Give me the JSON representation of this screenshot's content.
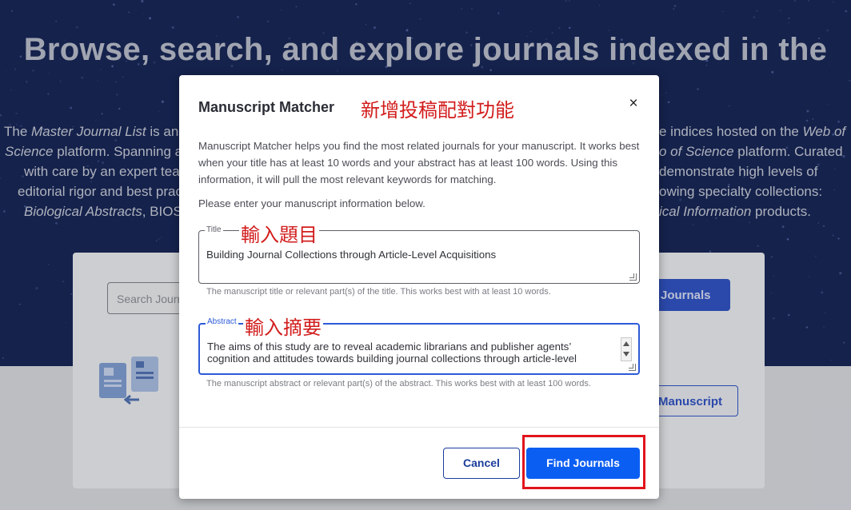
{
  "background": {
    "hero_title": "Browse, search, and explore journals indexed in the",
    "hero_lines": [
      {
        "left": "The ",
        "leftItalic": "Master Journal List",
        "leftRest": " is an i"
      },
      {
        "left": "",
        "leftItalic": "Science",
        "leftRest": " platform. Spanning a"
      },
      {
        "left": "with care by an expert tea",
        "leftItalic": "",
        "leftRest": ""
      },
      {
        "left": "editorial rigor and best prac",
        "leftItalic": "",
        "leftRest": ""
      },
      {
        "left": "",
        "leftItalic": "Biological Abstracts",
        "leftRest": ", BIOSI"
      }
    ],
    "hero_lines_right": [
      {
        "rest": "e indices hosted on the ",
        "italic": "Web of"
      },
      {
        "rest": "",
        "italic": "o of Science",
        "after": " platform. Curated"
      },
      {
        "rest": "demonstrate high levels of",
        "italic": ""
      },
      {
        "rest": "owing specialty collections:",
        "italic": ""
      },
      {
        "rest": "",
        "italic": "ical Information",
        "after": " products."
      }
    ],
    "search_placeholder": "Search Journ",
    "search_button": "Journals",
    "manuscript_button": "Manuscript"
  },
  "modal": {
    "title": "Manuscript Matcher",
    "description": "Manuscript Matcher helps you find the most related journals for your manuscript. It works best when your title has at least 10 words and your abstract has at least 100 words. Using this information, it will pull the most relevant keywords for matching.",
    "instruction": "Please enter your manuscript information below.",
    "title_field": {
      "label": "Title",
      "value": "Building Journal Collections through Article-Level Acquisitions",
      "helper": "The manuscript title or relevant part(s) of the title. This works best with at least 10 words."
    },
    "abstract_field": {
      "label": "Abstract",
      "value": "The aims of this study are to reveal academic librarians and publisher agents’ cognition and attitudes towards building journal collections through article-level",
      "helper": "The manuscript abstract or relevant part(s) of the abstract. This works best with at least 100 words."
    },
    "cancel_label": "Cancel",
    "find_label": "Find Journals",
    "close_symbol": "×"
  },
  "annotations": {
    "feature": "新增投稿配對功能",
    "title_hint": "輸入題目",
    "abstract_hint": "輸入摘要",
    "highlight_color": "#e1141c"
  },
  "colors": {
    "hero_bg": "#132150",
    "primary": "#0b5ef2",
    "focus": "#2d5bd7",
    "annotation": "#d21c1c"
  }
}
